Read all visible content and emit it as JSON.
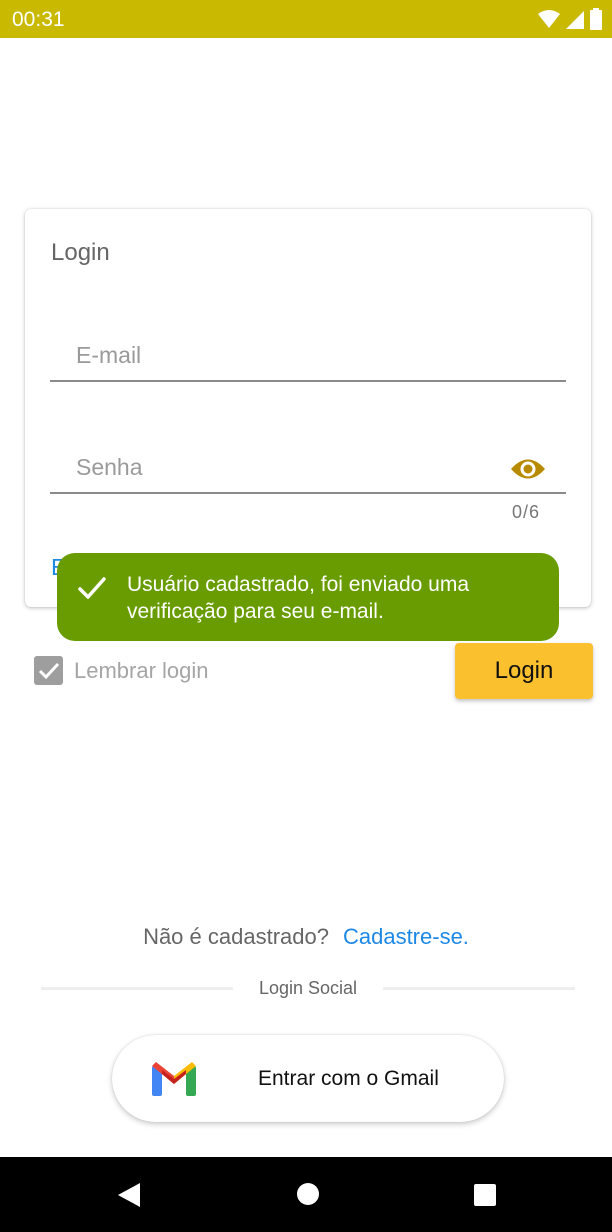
{
  "status_bar": {
    "time": "00:31",
    "icons": [
      "wifi-icon",
      "signal-icon",
      "battery-icon"
    ],
    "color": "#c9b900"
  },
  "login_card": {
    "title": "Login",
    "email_placeholder": "E-mail",
    "password_placeholder": "Senha",
    "password_counter": "0/6",
    "forgot_link_visible": "E"
  },
  "toast": {
    "message": "Usuário cadastrado, foi enviado uma verificação para seu e-mail.",
    "color": "#689c00"
  },
  "remember": {
    "label": "Lembrar login",
    "checked": true
  },
  "login_button": {
    "label": "Login",
    "color": "#fbc02d"
  },
  "signup": {
    "question": "Não é cadastrado?",
    "link": "Cadastre-se."
  },
  "social": {
    "divider_label": "Login Social",
    "gmail_button": "Entrar com o Gmail"
  },
  "nav_bar": {
    "buttons": [
      "back-icon",
      "home-icon",
      "recents-icon"
    ]
  }
}
